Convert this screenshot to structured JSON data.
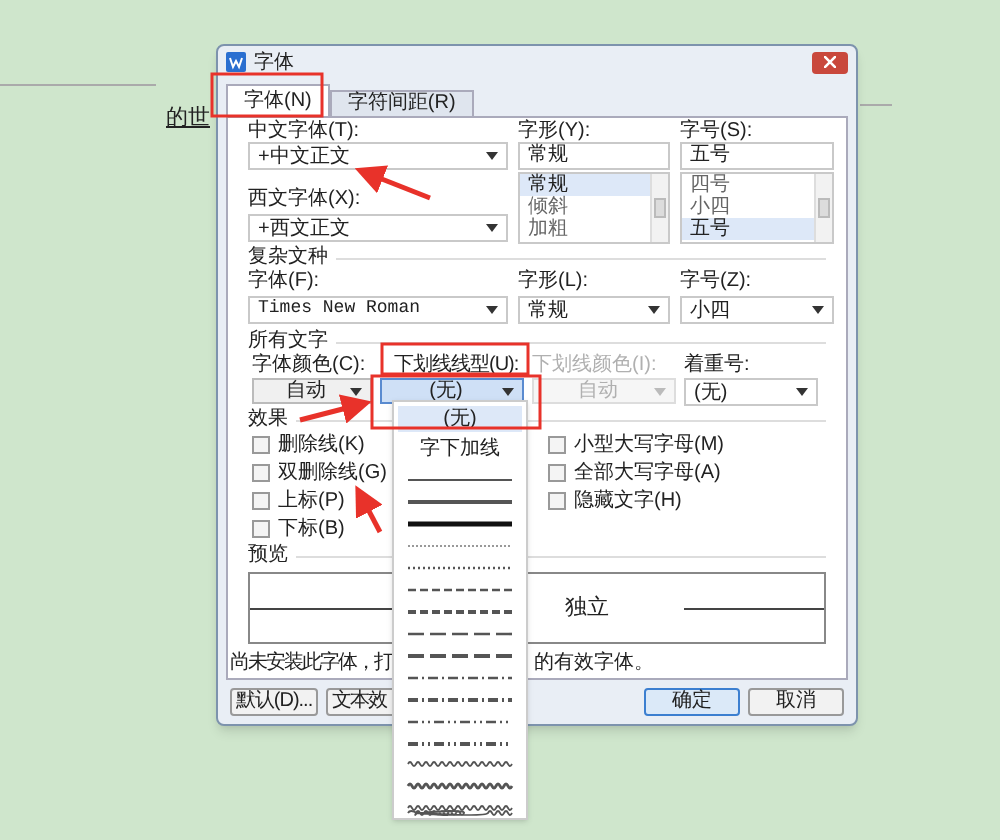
{
  "document": {
    "text": "的世"
  },
  "dialog": {
    "title": "字体",
    "tabs": [
      {
        "label": "字体(N)",
        "selected": true
      },
      {
        "label": "字符间距(R)",
        "selected": false
      }
    ],
    "chinese_font": {
      "label": "中文字体(T):",
      "value": "+中文正文"
    },
    "style": {
      "label": "字形(Y):",
      "value": "常规",
      "options": [
        {
          "label": "常规",
          "selected": true
        },
        {
          "label": "倾斜",
          "selected": false
        },
        {
          "label": "加粗",
          "selected": false
        }
      ]
    },
    "size": {
      "label": "字号(S):",
      "value": "五号",
      "options": [
        {
          "label": "四号",
          "selected": false
        },
        {
          "label": "小四",
          "selected": false
        },
        {
          "label": "五号",
          "selected": true
        }
      ]
    },
    "western_font": {
      "label": "西文字体(X):",
      "value": "+西文正文"
    },
    "complex_script": {
      "title": "复杂文种",
      "font": {
        "label": "字体(F):",
        "value": "Times New Roman"
      },
      "style": {
        "label": "字形(L):",
        "value": "常规"
      },
      "size": {
        "label": "字号(Z):",
        "value": "小四"
      }
    },
    "all_text": {
      "title": "所有文字",
      "font_color": {
        "label": "字体颜色(C):",
        "value": "自动"
      },
      "underline_type": {
        "label": "下划线线型(U):",
        "value": "(无)"
      },
      "underline_color": {
        "label": "下划线颜色(I):",
        "value": "自动",
        "disabled": true
      },
      "emphasis": {
        "label": "着重号:",
        "value": "(无)"
      }
    },
    "effects": {
      "title": "效果",
      "items": [
        {
          "label": "删除线(K)",
          "checked": false
        },
        {
          "label": "双删除线(G)",
          "checked": false
        },
        {
          "label": "上标(P)",
          "checked": false
        },
        {
          "label": "下标(B)",
          "checked": false
        },
        {
          "label": "小型大写字母(M)",
          "checked": false
        },
        {
          "label": "全部大写字母(A)",
          "checked": false
        },
        {
          "label": "隐藏文字(H)",
          "checked": false
        }
      ]
    },
    "preview": {
      "title": "预览",
      "text": "独立"
    },
    "note": [
      "尚未安装此字体，打",
      "的有效字体。"
    ],
    "buttons": [
      {
        "label": "默认(D)...",
        "kind": "plain"
      },
      {
        "label": "文本效",
        "kind": "plain"
      },
      {
        "label": "确定",
        "kind": "default"
      },
      {
        "label": "取消",
        "kind": "plain"
      }
    ]
  },
  "underline_dropdown": {
    "options": [
      {
        "label": "(无)",
        "selected": true
      },
      {
        "label": "字下加线",
        "selected": false
      }
    ],
    "line_styles": [
      {
        "kind": "thin"
      },
      {
        "kind": "medium"
      },
      {
        "kind": "thick"
      },
      {
        "kind": "dotted-fine"
      },
      {
        "kind": "dotted"
      },
      {
        "kind": "dashed"
      },
      {
        "kind": "dashed-bold"
      },
      {
        "kind": "long-dash"
      },
      {
        "kind": "long-dash-bold"
      },
      {
        "kind": "dash-dot"
      },
      {
        "kind": "dash-dot-bold"
      },
      {
        "kind": "dash-dot-dot"
      },
      {
        "kind": "dash-dot-dot-bold"
      },
      {
        "kind": "wave"
      },
      {
        "kind": "wave-heavy"
      },
      {
        "kind": "wave-double"
      }
    ]
  }
}
